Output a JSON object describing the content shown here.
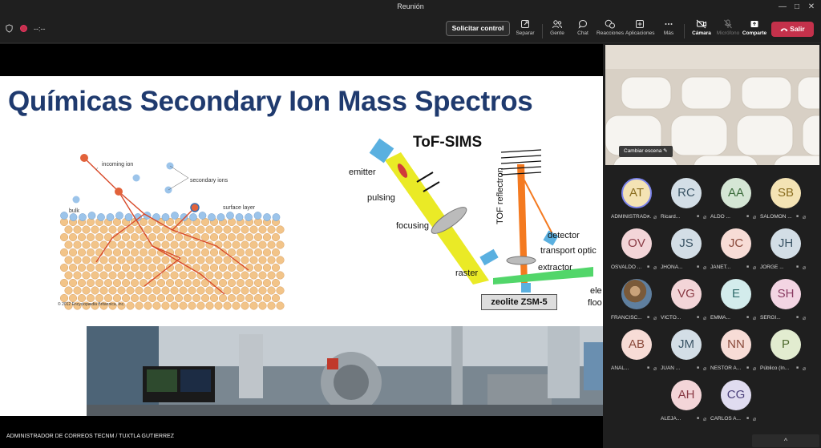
{
  "window": {
    "title": "Reunión"
  },
  "toolbar": {
    "timer": "--:--",
    "request_control": "Solicitar control",
    "items": [
      {
        "label": "Separar",
        "icon": "pop-out-icon"
      },
      {
        "label": "Gente",
        "icon": "people-icon"
      },
      {
        "label": "Chat",
        "icon": "chat-icon"
      },
      {
        "label": "Reacciones",
        "icon": "reactions-icon"
      },
      {
        "label": "Aplicaciones",
        "icon": "apps-icon"
      },
      {
        "label": "Más",
        "icon": "more-icon"
      },
      {
        "label": "Cámara",
        "icon": "camera-off-icon"
      },
      {
        "label": "Micrófono",
        "icon": "mic-off-icon"
      },
      {
        "label": "Comparte",
        "icon": "share-icon"
      }
    ],
    "leave": "Salir"
  },
  "slide": {
    "title": "Químicas Secondary Ion Mass Spectros",
    "tof_title": "ToF-SIMS",
    "diagram_labels": {
      "incoming_ion": "incoming ion",
      "secondary_ions": "secondary ions",
      "surface_layer": "surface layer",
      "bulk": "bulk",
      "copyright": "© 2012 Encyclopædia Britannica, Inc."
    },
    "tof_labels": {
      "emitter": "emitter",
      "pulsing": "pulsing",
      "focusing": "focusing",
      "raster": "raster",
      "reflectron": "TOF reflectron",
      "detector": "detector",
      "transport": "transport optic",
      "extractor": "extractor",
      "zeolite": "zeolite ZSM-5",
      "ele": "ele",
      "floo": "floo"
    }
  },
  "presenter": "ADMINISTRADOR DE CORREOS TECNM / TUXTLA GUTIERREZ",
  "video": {
    "scene_button": "Cambiar escena"
  },
  "participants": [
    {
      "initials": "AT",
      "name": "ADMINISTRAD...",
      "bg": "#f4e3b4",
      "fg": "#8a6d1f",
      "active": true
    },
    {
      "initials": "RC",
      "name": "Ricard...",
      "bg": "#d3dee6",
      "fg": "#3b5566"
    },
    {
      "initials": "AA",
      "name": "ALDO ...",
      "bg": "#d5e6d5",
      "fg": "#3b6b3b"
    },
    {
      "initials": "SB",
      "name": "SALOMON ...",
      "bg": "#f4e3b4",
      "fg": "#8a6d1f"
    },
    {
      "initials": "OV",
      "name": "OSVALDO ...",
      "bg": "#f3d5d8",
      "fg": "#8a3b45"
    },
    {
      "initials": "JS",
      "name": "JHONA...",
      "bg": "#d3dee6",
      "fg": "#3b5566"
    },
    {
      "initials": "JC",
      "name": "JANET...",
      "bg": "#f7dcd6",
      "fg": "#8a4a3b"
    },
    {
      "initials": "JH",
      "name": "JORGE ...",
      "bg": "#d3dee6",
      "fg": "#3b5566"
    },
    {
      "initials": "",
      "name": "FRANCISC...",
      "bg": "#8a6a4a",
      "fg": "#ffffff",
      "photo": true
    },
    {
      "initials": "VG",
      "name": "VICTO...",
      "bg": "#f3d5d8",
      "fg": "#8a3b45"
    },
    {
      "initials": "E",
      "name": "EMMA...",
      "bg": "#d3ecec",
      "fg": "#2f6b6b"
    },
    {
      "initials": "SH",
      "name": "SERGI...",
      "bg": "#f3d5e3",
      "fg": "#8a3b62"
    },
    {
      "initials": "AB",
      "name": "ANAL...",
      "bg": "#f7dcd6",
      "fg": "#8a4a3b"
    },
    {
      "initials": "JM",
      "name": "JUAN ...",
      "bg": "#d3dee6",
      "fg": "#3b5566"
    },
    {
      "initials": "NN",
      "name": "NESTOR A...",
      "bg": "#f7dcd6",
      "fg": "#8a4a3b"
    },
    {
      "initials": "P",
      "name": "Público (In...",
      "bg": "#e2ecd0",
      "fg": "#4f6b2f"
    },
    {
      "initials": "AH",
      "name": "ALEJA...",
      "bg": "#f3d5d8",
      "fg": "#8a3b45"
    },
    {
      "initials": "CG",
      "name": "CARLOS A...",
      "bg": "#e0dcf0",
      "fg": "#4a3f7a"
    }
  ],
  "scroll_up": "^"
}
